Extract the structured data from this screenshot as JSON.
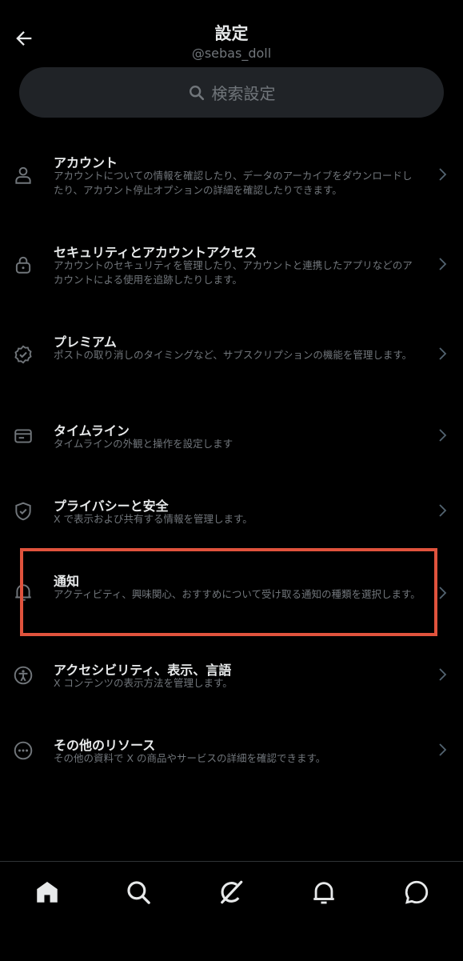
{
  "header": {
    "title": "設定",
    "subtitle": "@sebas_doll"
  },
  "search": {
    "placeholder": "検索設定"
  },
  "settings": [
    {
      "icon": "person-icon",
      "title": "アカウント",
      "description": "アカウントについての情報を確認したり、データのアーカイブをダウンロードしたり、アカウント停止オプションの詳細を確認したりできます。"
    },
    {
      "icon": "lock-icon",
      "title": "セキュリティとアカウントアクセス",
      "description": "アカウントのセキュリティを管理したり、アカウントと連携したアプリなどのアカウントによる使用を追跡したりします。"
    },
    {
      "icon": "verified-badge-icon",
      "title": "プレミアム",
      "description": "ポストの取り消しのタイミングなど、サブスクリプションの機能を管理します。"
    },
    {
      "icon": "timeline-icon",
      "title": "タイムライン",
      "description": "タイムラインの外観と操作を設定します"
    },
    {
      "icon": "shield-icon",
      "title": "プライバシーと安全",
      "description": "X で表示および共有する情報を管理します。"
    },
    {
      "icon": "bell-icon",
      "title": "通知",
      "description": "アクティビティ、興味関心、おすすめについて受け取る通知の種類を選択します。"
    },
    {
      "icon": "accessibility-icon",
      "title": "アクセシビリティ、表示、言語",
      "description": "X コンテンツの表示方法を管理します。"
    },
    {
      "icon": "more-circle-icon",
      "title": "その他のリソース",
      "description": "その他の資料で X の商品やサービスの詳細を確認できます。"
    }
  ],
  "bottom_nav": [
    "home-icon",
    "search-icon",
    "grok-icon",
    "notifications-icon",
    "messages-icon"
  ],
  "colors": {
    "background": "#000000",
    "text_primary": "#e7e9ea",
    "text_secondary": "#71767b",
    "search_bg": "#202327",
    "highlight": "#e0533d"
  }
}
